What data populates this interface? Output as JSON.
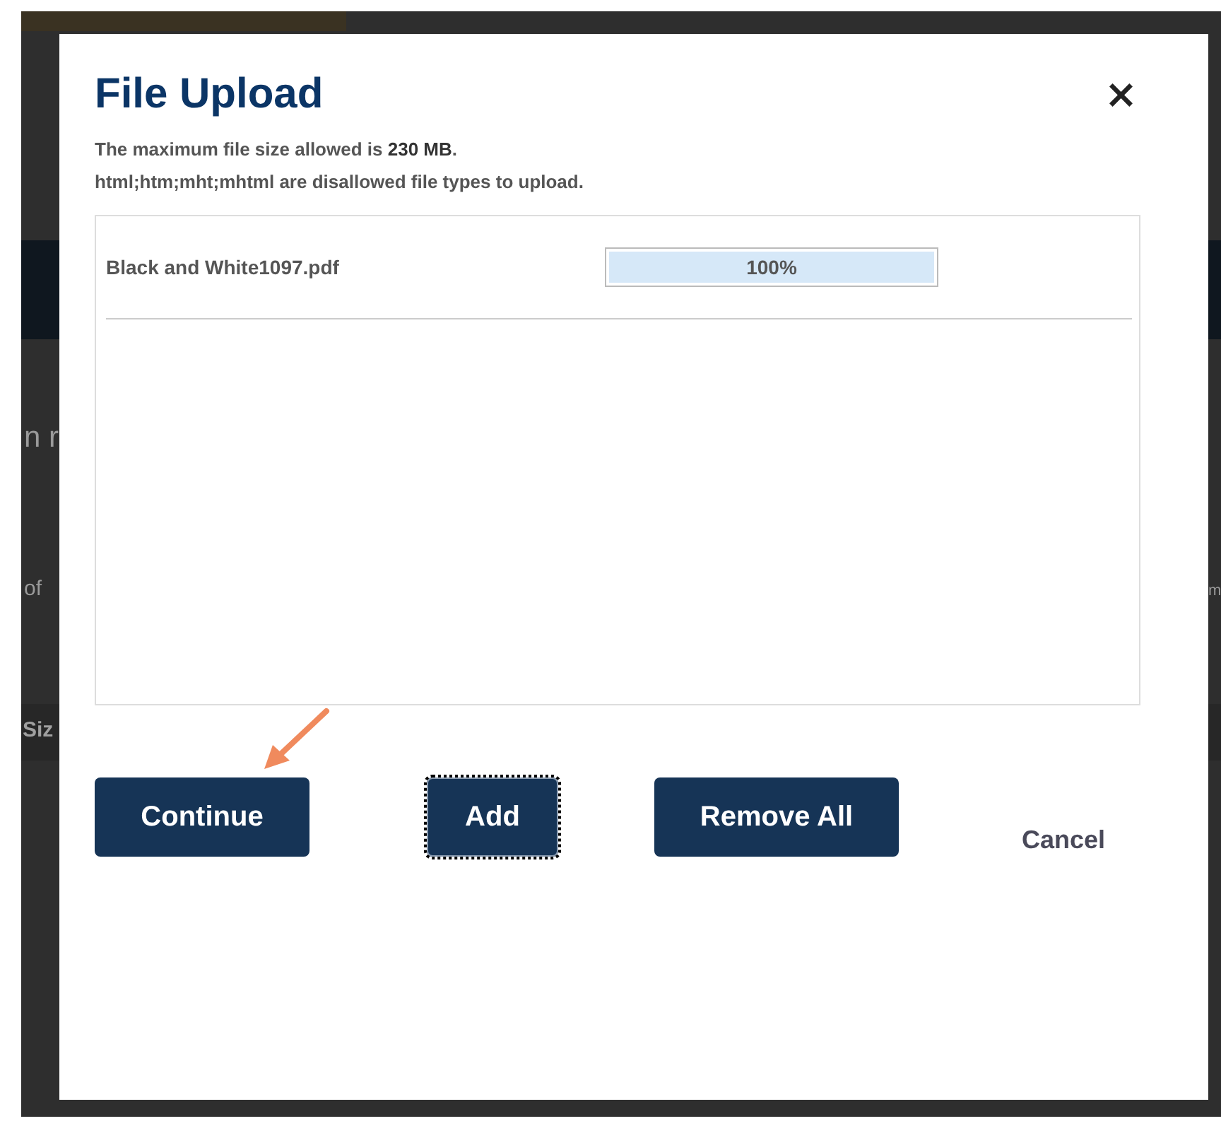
{
  "background_page": {
    "left_fragments": [
      {
        "text": "n r",
        "kind": "heading"
      },
      {
        "text": "of",
        "kind": "text"
      },
      {
        "text": "Siz",
        "kind": "header"
      }
    ],
    "right_fragments": [
      {
        "text": "m",
        "kind": "text"
      }
    ]
  },
  "dialog": {
    "title": "File Upload",
    "close": "×",
    "notes": [
      "The maximum file size allowed is **230 MB**.",
      "html;htm;mht;mhtml are disallowed file types to upload."
    ],
    "files": [
      {
        "name": "Black and White1097.pdf",
        "level": 1.0,
        "reading": "100%"
      }
    ],
    "buttons": [
      {
        "label": "Continue",
        "kind": "primary",
        "focused": false
      },
      {
        "label": "Add",
        "kind": "primary",
        "focused": true
      },
      {
        "label": "Remove All",
        "kind": "primary",
        "focused": false
      },
      {
        "label": "Cancel",
        "kind": "link",
        "focused": false
      }
    ],
    "annotation": {
      "kind": "arrow"
    }
  }
}
